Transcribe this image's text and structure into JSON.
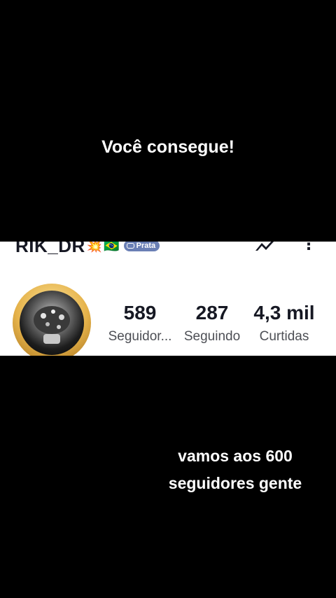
{
  "captions": {
    "top": "Você consegue!",
    "bottom_line1": "vamos aos 600",
    "bottom_line2": "seguidores gente"
  },
  "profile": {
    "username": "RIK_DR",
    "emojis": [
      "💥",
      "🇧🇷"
    ],
    "rank_badge": "Prata"
  },
  "stats": {
    "followers": {
      "value": "589",
      "label": "Seguidor..."
    },
    "following": {
      "value": "287",
      "label": "Seguindo"
    },
    "likes": {
      "value": "4,3 mil",
      "label": "Curtidas"
    }
  },
  "icons": {
    "edit": "pen-icon",
    "menu": "more-vertical-icon"
  },
  "colors": {
    "background": "#000000",
    "strip": "#ffffff",
    "text": "#161823",
    "badge": "#6a7fb5"
  }
}
